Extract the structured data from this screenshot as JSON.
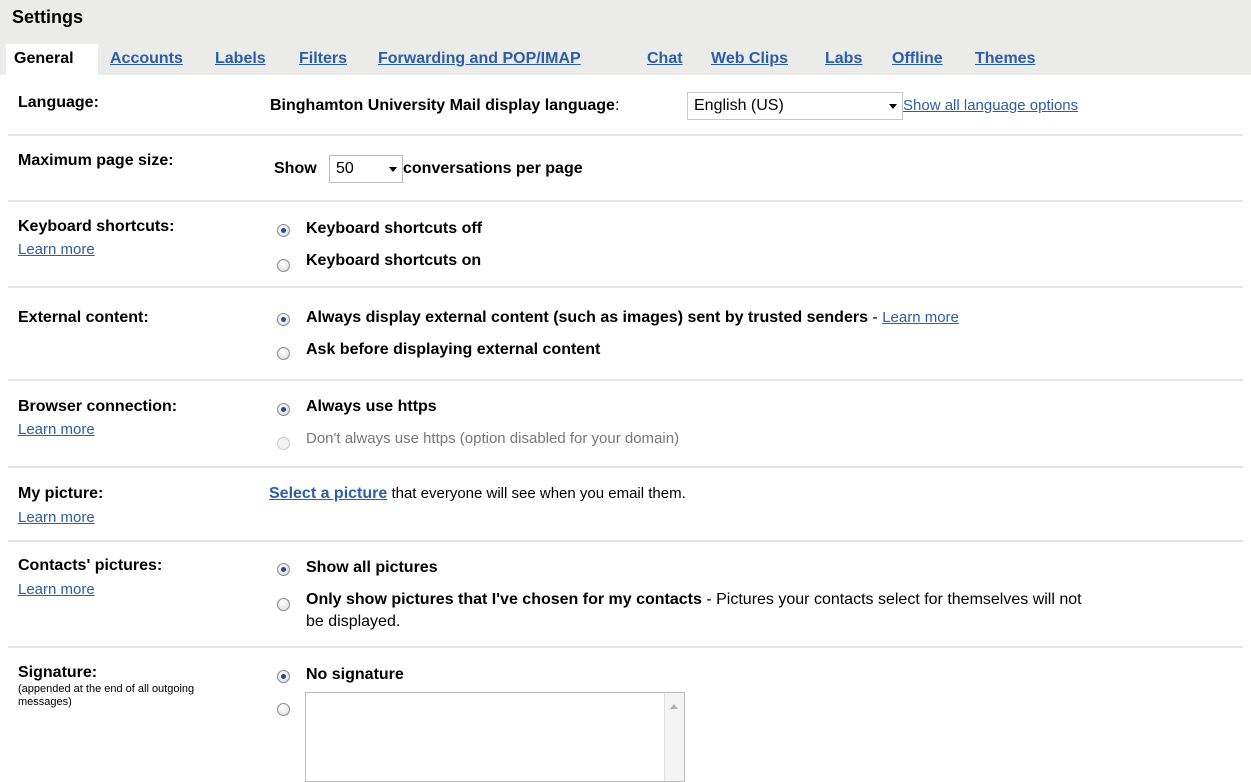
{
  "header": {
    "title": "Settings",
    "tabs": [
      {
        "label": "General",
        "active": true
      },
      {
        "label": "Accounts"
      },
      {
        "label": "Labels"
      },
      {
        "label": "Filters"
      },
      {
        "label": "Forwarding and POP/IMAP"
      },
      {
        "label": "Chat"
      },
      {
        "label": "Web Clips"
      },
      {
        "label": "Labs"
      },
      {
        "label": "Offline"
      },
      {
        "label": "Themes"
      }
    ]
  },
  "language": {
    "label": "Language:",
    "prompt": "Binghamton University Mail display language",
    "colon": ":",
    "selected": "English (US)",
    "show_all_link": "Show all language options"
  },
  "page_size": {
    "label": "Maximum page size:",
    "show": "Show",
    "selected": "50",
    "suffix": "conversations per page"
  },
  "keyboard": {
    "label": "Keyboard shortcuts:",
    "learn_more": "Learn more",
    "option_off": "Keyboard shortcuts off",
    "option_on": "Keyboard shortcuts on"
  },
  "external": {
    "label": "External content:",
    "option_always": "Always display external content (such as images) sent by trusted senders",
    "dash": " - ",
    "learn_more": "Learn more",
    "option_ask": "Ask before displaying external content"
  },
  "browser": {
    "label": "Browser connection:",
    "learn_more": "Learn more",
    "option_https": "Always use https",
    "option_no_https": "Don't always use https (option disabled for your domain)"
  },
  "picture": {
    "label": "My picture:",
    "learn_more": "Learn more",
    "select_link": "Select a picture",
    "suffix": " that everyone will see when you email them."
  },
  "contacts_pictures": {
    "label": "Contacts' pictures:",
    "learn_more": "Learn more",
    "option_all": "Show all pictures",
    "option_chosen": "Only show pictures that I've chosen for my contacts",
    "option_chosen_note_1": " - Pictures your contacts select for themselves will not",
    "option_chosen_note_2": "be displayed."
  },
  "signature": {
    "label": "Signature:",
    "sublabel": "(appended at the end of all outgoing messages)",
    "option_none": "No signature",
    "text_value": ""
  }
}
